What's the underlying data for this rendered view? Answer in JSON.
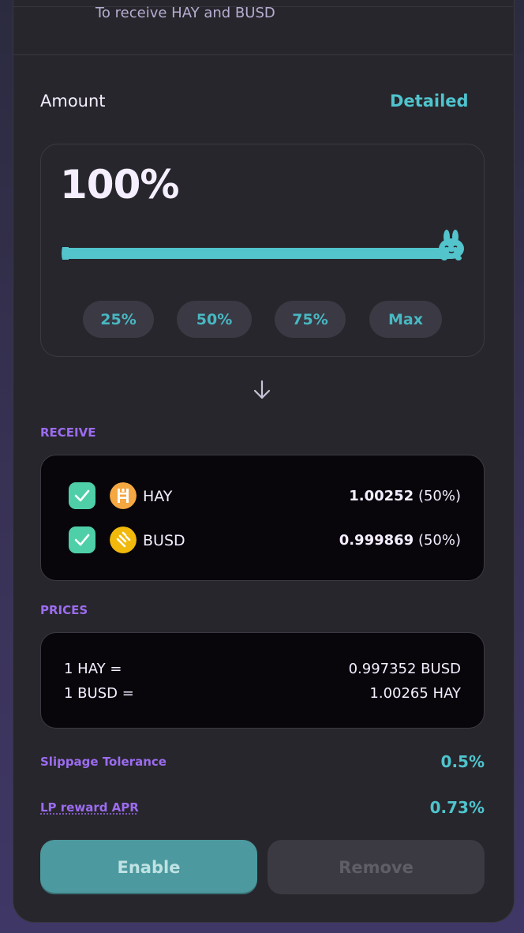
{
  "header": {
    "subtitle": "To receive HAY and BUSD"
  },
  "amount": {
    "label": "Amount",
    "detailed_link": "Detailed",
    "percent_text": "100%",
    "slider_value_percent": 100,
    "quick_buttons": [
      "25%",
      "50%",
      "75%",
      "Max"
    ]
  },
  "receive": {
    "label": "RECEIVE",
    "tokens": [
      {
        "symbol": "HAY",
        "amount": "1.00252",
        "share": "(50%)",
        "checked": true,
        "coin_color": "#f5a742"
      },
      {
        "symbol": "BUSD",
        "amount": "0.999869",
        "share": "(50%)",
        "checked": true,
        "coin_color": "#f0b90b"
      }
    ]
  },
  "prices": {
    "label": "PRICES",
    "rows": [
      {
        "left": "1 HAY =",
        "right": "0.997352 BUSD"
      },
      {
        "left": "1 BUSD =",
        "right": "1.00265 HAY"
      }
    ]
  },
  "info": {
    "slippage_label": "Slippage Tolerance",
    "slippage_value": "0.5%",
    "apr_label": "LP reward APR",
    "apr_value": "0.73%"
  },
  "actions": {
    "enable_label": "Enable",
    "remove_label": "Remove"
  },
  "colors": {
    "accent": "#4fc4cd",
    "section_label": "#9c6cf0",
    "card_bg": "#27262c",
    "dark_box": "#08060b"
  }
}
